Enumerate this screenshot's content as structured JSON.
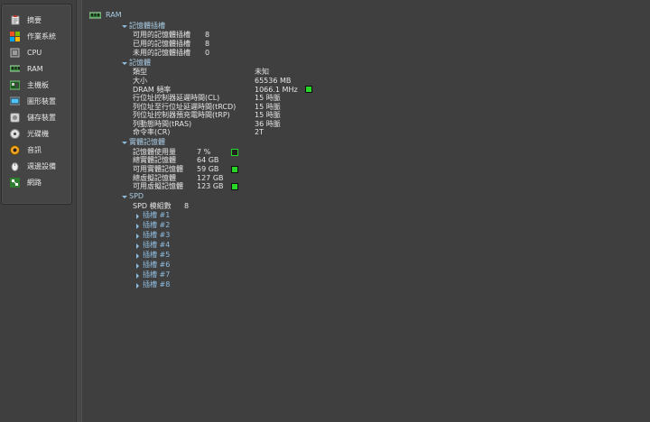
{
  "sidebar": {
    "items": [
      {
        "label": "摘要",
        "icon": "summary-icon"
      },
      {
        "label": "作業系統",
        "icon": "windows-icon"
      },
      {
        "label": "CPU",
        "icon": "cpu-icon"
      },
      {
        "label": "RAM",
        "icon": "ram-icon"
      },
      {
        "label": "主機板",
        "icon": "motherboard-icon"
      },
      {
        "label": "圖形裝置",
        "icon": "graphics-icon"
      },
      {
        "label": "儲存裝置",
        "icon": "storage-icon"
      },
      {
        "label": "光碟機",
        "icon": "optical-drive-icon"
      },
      {
        "label": "音訊",
        "icon": "audio-icon"
      },
      {
        "label": "週邊設備",
        "icon": "peripherals-icon"
      },
      {
        "label": "網路",
        "icon": "network-icon"
      }
    ]
  },
  "main": {
    "title": "RAM",
    "memory_slots": {
      "header": "記憶體插槽",
      "rows": [
        {
          "label": "可用的記憶體插槽",
          "value": "8"
        },
        {
          "label": "已用的記憶體插槽",
          "value": "8"
        },
        {
          "label": "未用的記憶體插槽",
          "value": "0"
        }
      ]
    },
    "memory": {
      "header": "記憶體",
      "rows": [
        {
          "label": "類型",
          "value": "未知"
        },
        {
          "label": "大小",
          "value": "65536 MB"
        },
        {
          "label": "DRAM 頻率",
          "value": "1066.1 MHz"
        },
        {
          "label": "行位址控制器延遲時間(CL)",
          "value": "15 時脈"
        },
        {
          "label": "列位址至行位址延遲時間(tRCD)",
          "value": "15 時脈"
        },
        {
          "label": "列位址控制器預充電時間(tRP)",
          "value": "15 時脈"
        },
        {
          "label": "列動態時間(tRAS)",
          "value": "36 時脈"
        },
        {
          "label": "命令率(CR)",
          "value": "2T"
        }
      ]
    },
    "physical_memory": {
      "header": "實體記憶體",
      "rows": [
        {
          "label": "記憶體使用量",
          "value": "7 %"
        },
        {
          "label": "總實體記憶體",
          "value": "64 GB"
        },
        {
          "label": "可用實體記憶體",
          "value": "59 GB"
        },
        {
          "label": "總虛擬記憶體",
          "value": "127 GB"
        },
        {
          "label": "可用虛擬記憶體",
          "value": "123 GB"
        }
      ]
    },
    "spd": {
      "header": "SPD",
      "module_count_label": "SPD 模組數",
      "module_count": "8",
      "slots": [
        "插槽 #1",
        "插槽 #2",
        "插槽 #3",
        "插槽 #4",
        "插槽 #5",
        "插槽 #6",
        "插槽 #7",
        "插槽 #8"
      ]
    }
  },
  "colors": {
    "background": "#3f3f3f",
    "header_blue": "#a9cbe3",
    "indicator_green": "#27d627"
  }
}
